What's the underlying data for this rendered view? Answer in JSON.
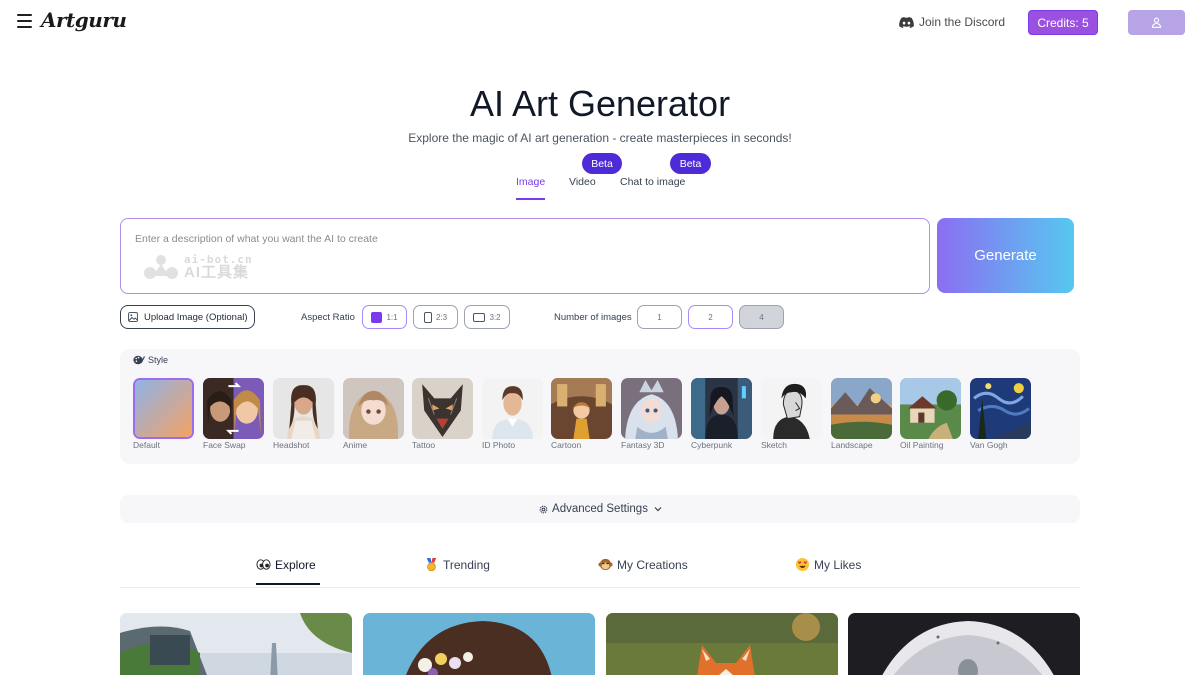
{
  "header": {
    "logo": "Artguru",
    "discord_label": "Join the Discord",
    "credits_label": "Credits: 5"
  },
  "hero": {
    "title": "AI Art Generator",
    "subtitle": "Explore the magic of AI art generation - create masterpieces in seconds!",
    "beta_badges": [
      "Beta",
      "Beta"
    ],
    "tabs": [
      {
        "label": "Image",
        "active": true
      },
      {
        "label": "Video",
        "active": false
      },
      {
        "label": "Chat to image",
        "active": false
      }
    ]
  },
  "prompt": {
    "placeholder": "Enter a description of what you want the AI to create",
    "watermark_line1": "ai-bot.cn",
    "watermark_line2": "AI工具集",
    "generate_label": "Generate"
  },
  "options": {
    "upload_label": "Upload Image (Optional)",
    "aspect_label": "Aspect Ratio",
    "aspect_ratios": [
      {
        "label": "1:1",
        "selected": true
      },
      {
        "label": "2:3",
        "selected": false
      },
      {
        "label": "3:2",
        "selected": false
      }
    ],
    "number_label": "Number of images",
    "numbers": [
      {
        "label": "1",
        "state": "default"
      },
      {
        "label": "2",
        "state": "selected"
      },
      {
        "label": "4",
        "state": "disabled"
      }
    ]
  },
  "style": {
    "label": "Style",
    "items": [
      {
        "name": "Default",
        "selected": true
      },
      {
        "name": "Face Swap",
        "selected": false
      },
      {
        "name": "Headshot",
        "selected": false
      },
      {
        "name": "Anime",
        "selected": false
      },
      {
        "name": "Tattoo",
        "selected": false
      },
      {
        "name": "ID Photo",
        "selected": false
      },
      {
        "name": "Cartoon",
        "selected": false
      },
      {
        "name": "Fantasy 3D",
        "selected": false
      },
      {
        "name": "Cyberpunk",
        "selected": false
      },
      {
        "name": "Sketch",
        "selected": false
      },
      {
        "name": "Landscape",
        "selected": false
      },
      {
        "name": "Oil Painting",
        "selected": false
      },
      {
        "name": "Van Gogh",
        "selected": false
      }
    ]
  },
  "advanced": {
    "label": "Advanced Settings"
  },
  "feed": {
    "tabs": [
      {
        "label": "Explore",
        "icon": "eyes-icon",
        "active": true
      },
      {
        "label": "Trending",
        "icon": "medal-icon",
        "active": false
      },
      {
        "label": "My Creations",
        "icon": "monkey-face-icon",
        "active": false
      },
      {
        "label": "My Likes",
        "icon": "heart-eyes-icon",
        "active": false
      }
    ]
  },
  "colors": {
    "accent": "#7c3aed",
    "beta_badge": "#4f2bd8",
    "credits_bg": "#9b51e0",
    "generate_gradient_start": "#8b6ef2",
    "generate_gradient_end": "#56c8f0"
  }
}
